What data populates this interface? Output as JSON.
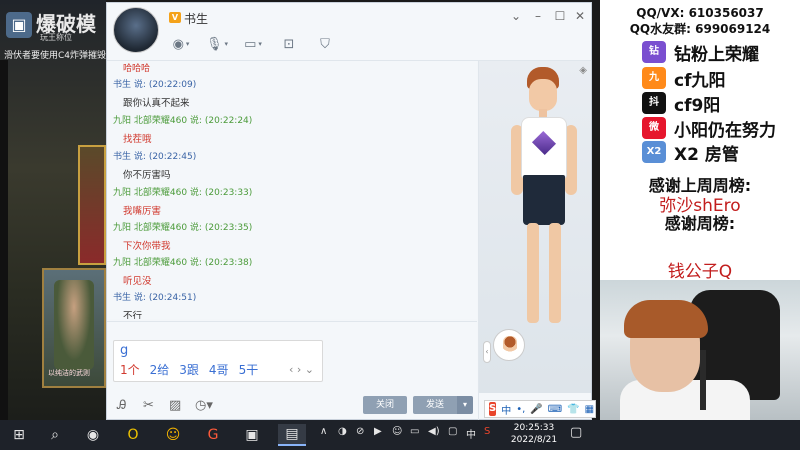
{
  "game": {
    "title": "爆破模",
    "subtitle": "玩王称位",
    "tip": "滑伏者要使用C4炸弹摧毁",
    "card_label": "以纯洁的武则"
  },
  "chat": {
    "contact_name": "书生",
    "messages": [
      {
        "sender": "书生",
        "time": "(20:22:09)",
        "text": "跟你认真不起来",
        "color": "normal"
      },
      {
        "sender": "九阳 北部荣耀460",
        "time": "(20:22:24)",
        "text": "找茬哦",
        "color": "red"
      },
      {
        "sender": "书生",
        "time": "(20:22:45)",
        "text": "你不厉害吗",
        "color": "normal"
      },
      {
        "sender": "九阳 北部荣耀460",
        "time": "(20:23:33)",
        "text": "我嘴厉害",
        "color": "red"
      },
      {
        "sender": "九阳 北部荣耀460",
        "time": "(20:23:35)",
        "text": "下次你带我",
        "color": "red"
      },
      {
        "sender": "九阳 北部荣耀460",
        "time": "(20:23:38)",
        "text": "听见没",
        "color": "red"
      },
      {
        "sender": "书生",
        "time": "(20:24:51)",
        "text": "不行",
        "color": "normal"
      }
    ],
    "says_suffix": "说:",
    "ime_typed": "g",
    "ime_candidates": [
      "1个",
      "2给",
      "3跟",
      "4哥",
      "5干"
    ],
    "close_label": "关闭",
    "send_label": "发送"
  },
  "overlay": {
    "qq_vx": "QQ/VX: 610356037",
    "qq_group": "QQ水友群: 699069124",
    "rows": [
      {
        "icon": "钻",
        "text": "钻粉上荣耀",
        "icon_color": "#7a4fd0"
      },
      {
        "icon": "九",
        "text": "cf九阳",
        "icon_color": "#ff8a1a"
      },
      {
        "icon": "抖",
        "text": "cf9阳",
        "icon_color": "#111111"
      },
      {
        "icon": "微",
        "text": "小阳仍在努力",
        "icon_color": "#e6162d"
      },
      {
        "icon": "X2",
        "text": "X2 房管",
        "icon_color": "#5a8fd6"
      }
    ],
    "thanks_last_week": "感谢上周周榜:",
    "last_week_name": "弥沙shEro",
    "thanks_week": "感谢周榜:",
    "week_name": "钱公子Q"
  },
  "taskbar": {
    "time": "20:25:33",
    "date": "2022/8/21",
    "ime_lang": "中"
  }
}
